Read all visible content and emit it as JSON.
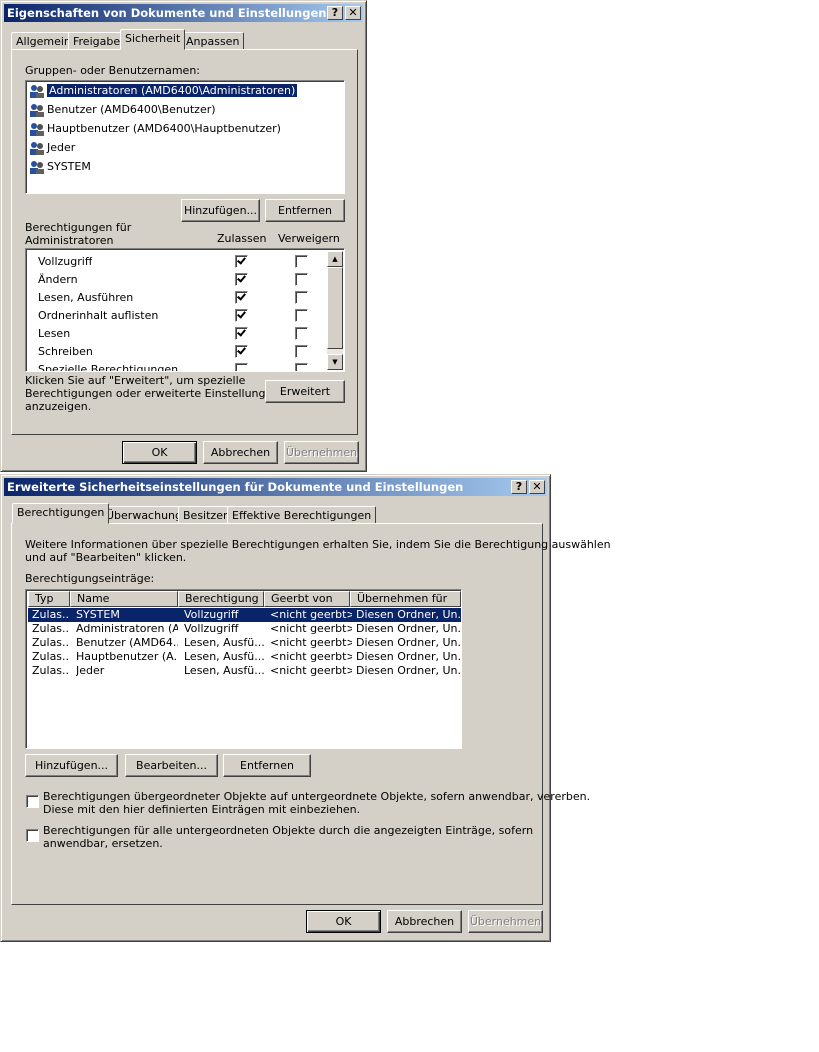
{
  "win1": {
    "title": "Eigenschaften von Dokumente und Einstellungen",
    "tabs": [
      "Allgemein",
      "Freigabe",
      "Sicherheit",
      "Anpassen"
    ],
    "group_label": "Gruppen- oder Benutzernamen:",
    "users": [
      "Administratoren (AMD6400\\Administratoren)",
      "Benutzer (AMD6400\\Benutzer)",
      "Hauptbenutzer (AMD6400\\Hauptbenutzer)",
      "Jeder",
      "SYSTEM"
    ],
    "add_button": "Hinzufügen...",
    "remove_button": "Entfernen",
    "perm_for_line1": "Berechtigungen für",
    "perm_for_line2": "Administratoren",
    "col_allow": "Zulassen",
    "col_deny": "Verweigern",
    "permissions": [
      {
        "name": "Vollzugriff",
        "allow": true,
        "deny": false
      },
      {
        "name": "Ändern",
        "allow": true,
        "deny": false
      },
      {
        "name": "Lesen, Ausführen",
        "allow": true,
        "deny": false
      },
      {
        "name": "Ordnerinhalt auflisten",
        "allow": true,
        "deny": false
      },
      {
        "name": "Lesen",
        "allow": true,
        "deny": false
      },
      {
        "name": "Schreiben",
        "allow": true,
        "deny": false
      },
      {
        "name": "Spezielle Berechtigungen",
        "allow": false,
        "deny": false
      }
    ],
    "info_line1": "Klicken Sie auf \"Erweitert\", um spezielle",
    "info_line2": "Berechtigungen oder erweiterte Einstellungen",
    "info_line3": "anzuzeigen.",
    "advanced_button": "Erweitert",
    "ok": "OK",
    "cancel": "Abbrechen",
    "apply": "Übernehmen"
  },
  "win2": {
    "title": "Erweiterte Sicherheitseinstellungen für Dokumente und Einstellungen",
    "tabs": [
      "Berechtigungen",
      "Überwachung",
      "Besitzer",
      "Effektive Berechtigungen"
    ],
    "info_line1": "Weitere Informationen über spezielle Berechtigungen erhalten Sie, indem Sie die Berechtigung auswählen",
    "info_line2": "und auf \"Bearbeiten\" klicken.",
    "entries_label": "Berechtigungseinträge:",
    "columns": [
      "Typ",
      "Name",
      "Berechtigung",
      "Geerbt von",
      "Übernehmen für"
    ],
    "rows": [
      [
        "Zulas...",
        "SYSTEM",
        "Vollzugriff",
        "<nicht geerbt>",
        "Diesen Ordner, Un..."
      ],
      [
        "Zulas...",
        "Administratoren (A...",
        "Vollzugriff",
        "<nicht geerbt>",
        "Diesen Ordner, Un..."
      ],
      [
        "Zulas...",
        "Benutzer (AMD64...",
        "Lesen, Ausfü...",
        "<nicht geerbt>",
        "Diesen Ordner, Un..."
      ],
      [
        "Zulas...",
        "Hauptbenutzer (A...",
        "Lesen, Ausfü...",
        "<nicht geerbt>",
        "Diesen Ordner, Un..."
      ],
      [
        "Zulas...",
        "Jeder",
        "Lesen, Ausfü...",
        "<nicht geerbt>",
        "Diesen Ordner, Un..."
      ]
    ],
    "add_button": "Hinzufügen...",
    "edit_button": "Bearbeiten...",
    "remove_button": "Entfernen",
    "inherit_line1": "Berechtigungen übergeordneter Objekte auf untergeordnete Objekte, sofern anwendbar, vererben.",
    "inherit_line2": "Diese mit den hier definierten Einträgen mit einbeziehen.",
    "replace_line1": "Berechtigungen für alle untergeordneten Objekte durch die angezeigten Einträge, sofern",
    "replace_line2": "anwendbar, ersetzen.",
    "ok": "OK",
    "cancel": "Abbrechen",
    "apply": "Übernehmen"
  }
}
